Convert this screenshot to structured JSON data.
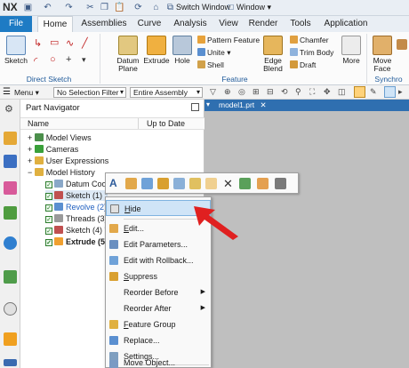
{
  "app": {
    "logo": "NX"
  },
  "quick_access": {
    "switch_window": "Switch Window",
    "window": "Window"
  },
  "tabs": [
    "File",
    "Home",
    "Assemblies",
    "Curve",
    "Analysis",
    "View",
    "Render",
    "Tools",
    "Application"
  ],
  "ribbon": {
    "direct_sketch": {
      "label": "Direct Sketch",
      "sketch": "Sketch"
    },
    "feature": {
      "label": "Feature",
      "datum_plane": "Datum\nPlane",
      "extrude": "Extrude",
      "hole": "Hole",
      "pattern_feature": "Pattern Feature",
      "unite": "Unite",
      "shell": "Shell",
      "edge_blend": "Edge\nBlend",
      "chamfer": "Chamfer",
      "trim_body": "Trim Body",
      "draft": "Draft",
      "more": "More"
    },
    "synchronous": {
      "label": "Synchro",
      "move_face": "Move\nFace"
    }
  },
  "toolbar": {
    "menu": "Menu",
    "selection_filter": "No Selection Filter",
    "scope": "Entire Assembly"
  },
  "navigator": {
    "title": "Part Navigator",
    "col_name": "Name",
    "col_uptodate": "Up to Date",
    "items": [
      {
        "label": "Model Views"
      },
      {
        "label": "Cameras"
      },
      {
        "label": "User Expressions"
      },
      {
        "label": "Model History"
      },
      {
        "label": "Datum Coo"
      },
      {
        "label": "Sketch (1) \""
      },
      {
        "label": "Revolve (2)"
      },
      {
        "label": "Threads (3)"
      },
      {
        "label": "Sketch (4) \""
      },
      {
        "label": "Extrude (5)"
      }
    ]
  },
  "graphics": {
    "tab_label": "model1.prt"
  },
  "context_menu": {
    "items": [
      {
        "key": "hide",
        "label": "Hide",
        "accel": "H",
        "rest": "ide"
      },
      {
        "key": "edit",
        "label": "Edit...",
        "accel": "E",
        "rest": "dit..."
      },
      {
        "key": "edit-parameters",
        "label": "Edit Parameters...",
        "accel": "",
        "rest": "Edit Parameters..."
      },
      {
        "key": "edit-rollback",
        "label": "Edit with Rollback...",
        "accel": "",
        "rest": "Edit with Rollback..."
      },
      {
        "key": "suppress",
        "label": "Suppress",
        "accel": "S",
        "rest": "uppress"
      },
      {
        "key": "reorder-before",
        "label": "Reorder Before",
        "accel": "",
        "rest": "Reorder Before"
      },
      {
        "key": "reorder-after",
        "label": "Reorder After",
        "accel": "",
        "rest": "Reorder After"
      },
      {
        "key": "feature-group",
        "label": "Feature Group",
        "accel": "F",
        "rest": "eature Group"
      },
      {
        "key": "replace",
        "label": "Replace...",
        "accel": "",
        "rest": "Replace..."
      },
      {
        "key": "settings",
        "label": "Settings...",
        "accel": "",
        "rest": "Settings..."
      },
      {
        "key": "move-object",
        "label": "Move Object...",
        "accel": "",
        "rest": "Move Object..."
      }
    ]
  },
  "colors": {
    "accent": "#1e7bc4",
    "arrow": "#e02020",
    "highlight": "#cfe4f7",
    "graphics_bg": "#bfbfbf"
  }
}
